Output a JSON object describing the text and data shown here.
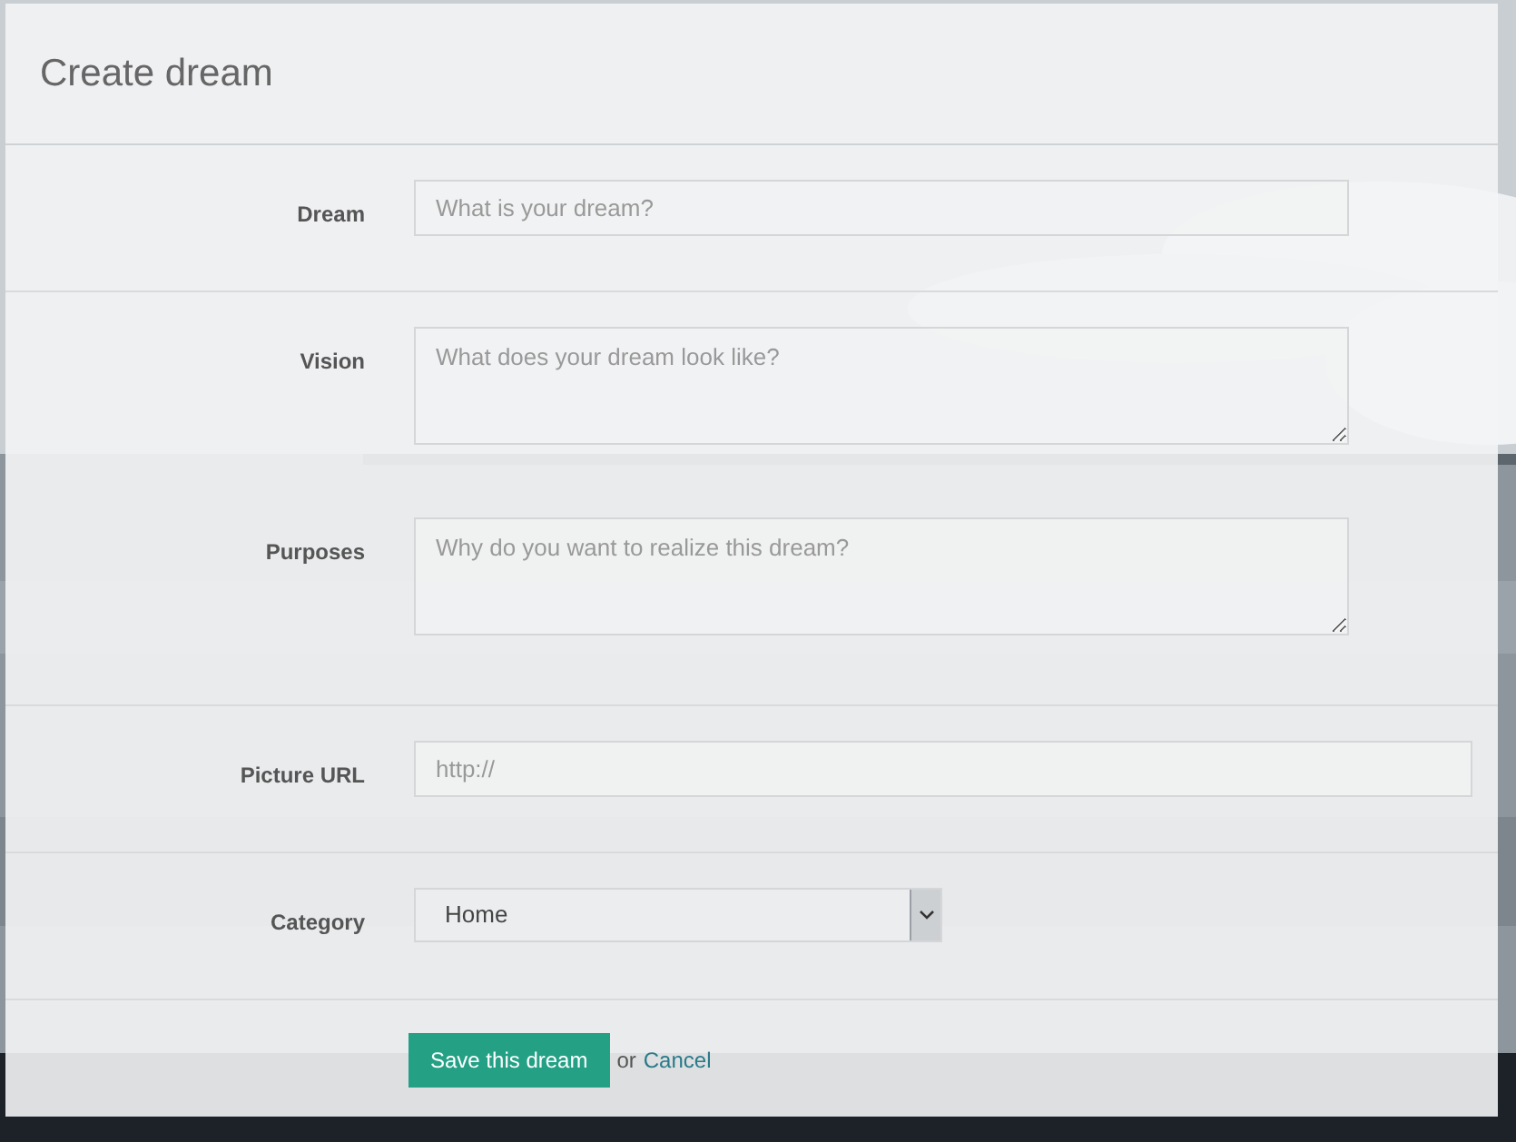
{
  "title": "Create dream",
  "sections": [
    {
      "fields": [
        {
          "kind": "text",
          "label": "Dream",
          "placeholder": "What is your dream?"
        }
      ]
    },
    {
      "fields": [
        {
          "kind": "textarea",
          "label": "Vision",
          "placeholder": "What does your dream look like?"
        },
        {
          "kind": "textarea",
          "label": "Purposes",
          "placeholder": "Why do you want to realize this dream?"
        }
      ]
    },
    {
      "fields": [
        {
          "kind": "url",
          "label": "Picture URL",
          "placeholder": "http://"
        }
      ]
    },
    {
      "fields": [
        {
          "kind": "select",
          "label": "Category",
          "value": "Home"
        }
      ]
    }
  ],
  "actions": {
    "submit": "Save this dream",
    "separator": "or",
    "cancel": "Cancel"
  }
}
